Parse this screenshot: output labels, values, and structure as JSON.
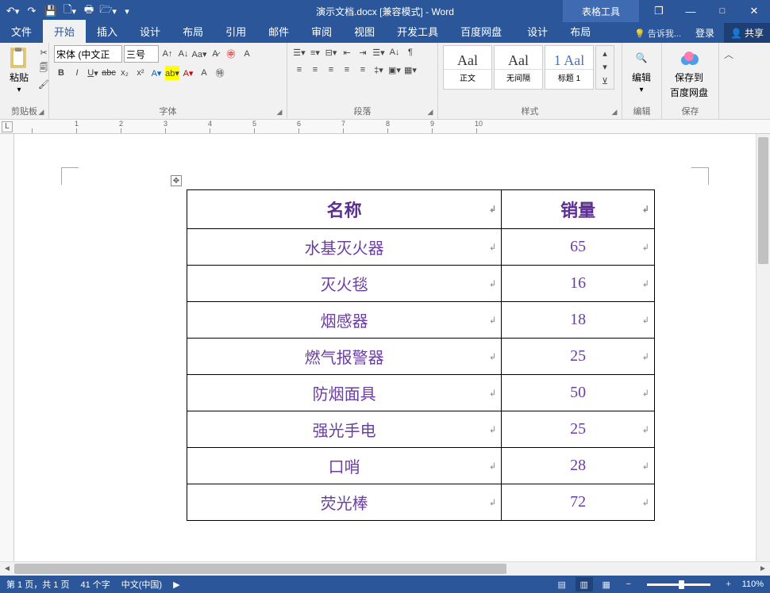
{
  "title": "演示文档.docx [兼容模式] - Word",
  "table_tools_label": "表格工具",
  "qat": [
    "save",
    "undo",
    "redo",
    "new",
    "print",
    "open",
    "touch"
  ],
  "window": {
    "restore": "❐",
    "min": "—",
    "max": "□",
    "close": "✕"
  },
  "tabs": {
    "file": "文件",
    "home": "开始",
    "insert": "插入",
    "design": "设计",
    "layout": "布局",
    "references": "引用",
    "mailings": "邮件",
    "review": "审阅",
    "view": "视图",
    "developer": "开发工具",
    "baidu": "百度网盘",
    "tdesign": "设计",
    "tlayout": "布局"
  },
  "tellme": "告诉我...",
  "login": "登录",
  "share": "共享",
  "ribbon": {
    "clipboard": {
      "label": "剪贴板",
      "paste": "粘贴"
    },
    "font": {
      "label": "字体",
      "name": "宋体 (中文正",
      "size": "三号"
    },
    "paragraph": {
      "label": "段落"
    },
    "styles": {
      "label": "样式",
      "s1": "正文",
      "s2": "无间隔",
      "s3": "标题 1",
      "preview": "Aal",
      "preview3": "1 Aal"
    },
    "editing": {
      "label": "编辑",
      "btn": "编辑"
    },
    "save_cloud": {
      "label": "保存",
      "btn": "保存到",
      "btn2": "百度网盘"
    }
  },
  "ruler_labels": [
    "",
    "1",
    "2",
    "3",
    "4",
    "5",
    "6",
    "7",
    "8",
    "9",
    "10"
  ],
  "table": {
    "headers": [
      "名称",
      "销量"
    ],
    "rows": [
      [
        "水基灭火器",
        "65"
      ],
      [
        "灭火毯",
        "16"
      ],
      [
        "烟感器",
        "18"
      ],
      [
        "燃气报警器",
        "25"
      ],
      [
        "防烟面具",
        "50"
      ],
      [
        "强光手电",
        "25"
      ],
      [
        "口哨",
        "28"
      ],
      [
        "荧光棒",
        "72"
      ]
    ]
  },
  "chart_data": {
    "type": "table",
    "title": "",
    "columns": [
      "名称",
      "销量"
    ],
    "rows": [
      {
        "名称": "水基灭火器",
        "销量": 65
      },
      {
        "名称": "灭火毯",
        "销量": 16
      },
      {
        "名称": "烟感器",
        "销量": 18
      },
      {
        "名称": "燃气报警器",
        "销量": 25
      },
      {
        "名称": "防烟面具",
        "销量": 50
      },
      {
        "名称": "强光手电",
        "销量": 25
      },
      {
        "名称": "口哨",
        "销量": 28
      },
      {
        "名称": "荧光棒",
        "销量": 72
      }
    ]
  },
  "status": {
    "page": "第 1 页，共 1 页",
    "words": "41 个字",
    "lang": "中文(中国)",
    "zoom": "110%"
  }
}
